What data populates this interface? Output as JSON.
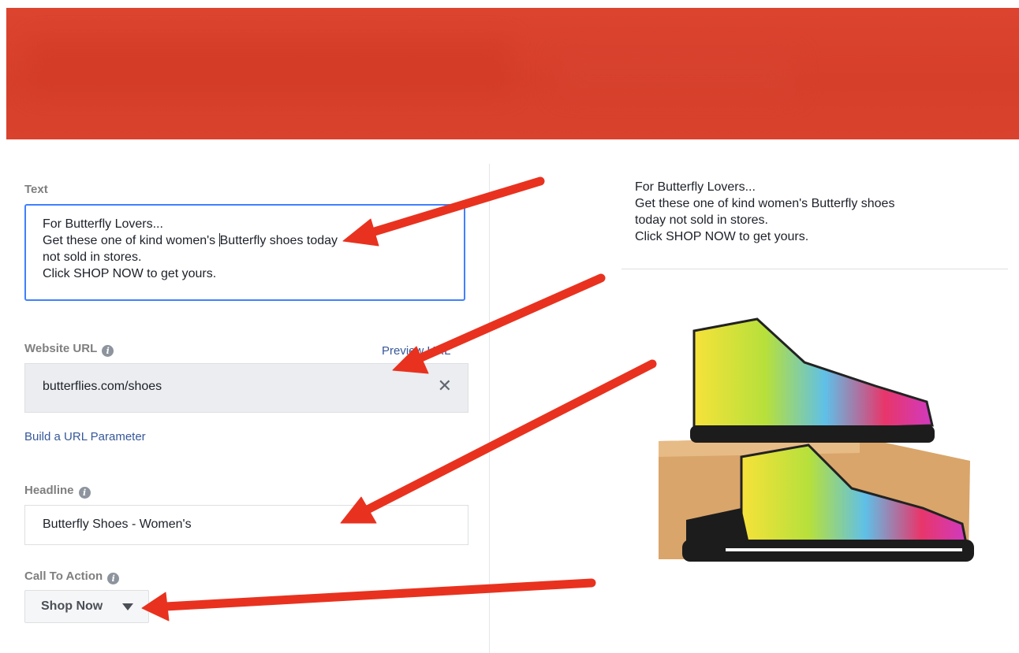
{
  "form": {
    "text_label": "Text",
    "text_lines": [
      "For Butterfly Lovers...",
      "Get these one of kind women's ",
      "Butterfly shoes today",
      "not sold in stores.",
      "Click SHOP NOW to get yours."
    ],
    "website_url_label": "Website URL",
    "preview_url_link": "Preview URL",
    "website_url_value": "butterflies.com/shoes",
    "clear_symbol": "✕",
    "build_url_link": "Build a URL Parameter",
    "headline_label": "Headline",
    "headline_value": "Butterfly Shoes - Women's",
    "cta_label": "Call To Action",
    "cta_value": "Shop Now"
  },
  "preview": {
    "text_lines": [
      "For Butterfly Lovers...",
      "Get these one of kind women's Butterfly shoes",
      "today not sold in stores.",
      "Click SHOP NOW to get yours."
    ]
  },
  "colors": {
    "banner": "#d63f2a",
    "arrow": "#e8321f",
    "link": "#365899",
    "focus_border": "#4080ff"
  },
  "icons": {
    "info": "info-icon",
    "clear": "close-icon",
    "dropdown": "caret-down-icon"
  }
}
